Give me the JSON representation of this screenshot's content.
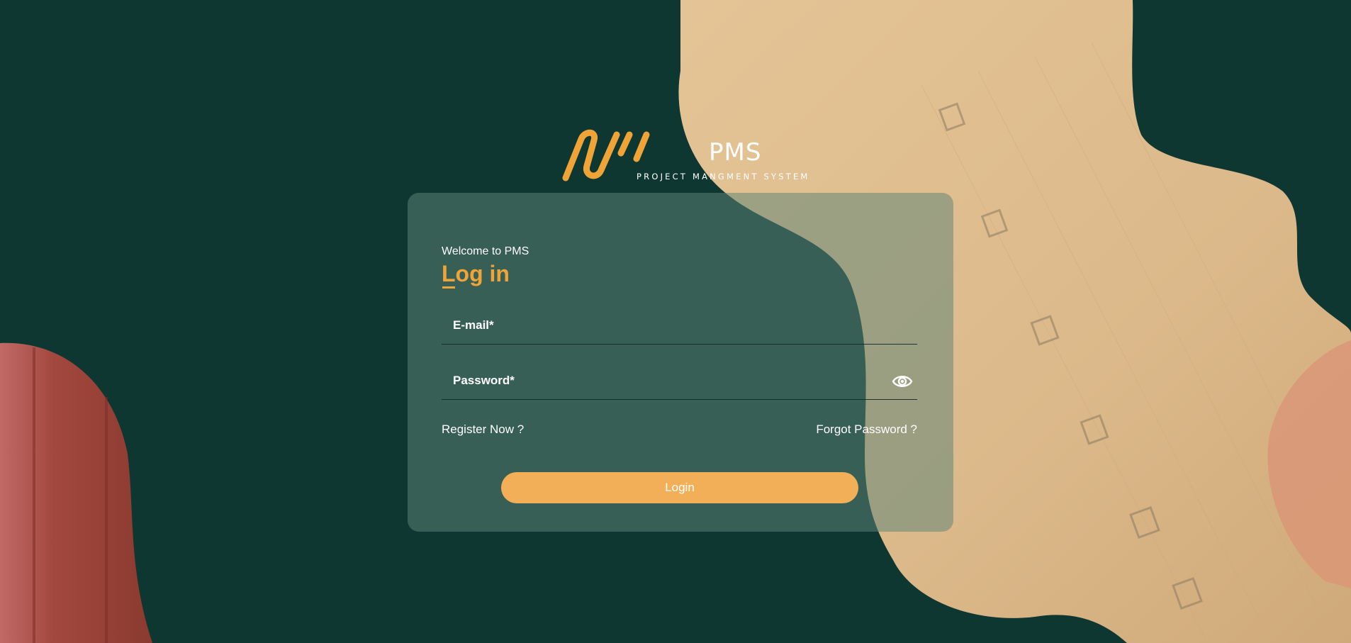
{
  "brand": {
    "title": "PMS",
    "subtitle": "PROJECT MANGMENT SYSTEM",
    "accent": "#f0a438"
  },
  "colors": {
    "background": "#0f3731",
    "card": "#5d8476",
    "button": "#f2af58"
  },
  "form": {
    "welcome": "Welcome to PMS",
    "heading": "Log in",
    "email_label": "E-mail*",
    "password_label": "Password*",
    "register_link": "Register Now ?",
    "forgot_link": "Forgot Password ?",
    "login_button": "Login"
  },
  "icons": {
    "password_toggle": "eye-icon",
    "logo": "logo-icon"
  }
}
